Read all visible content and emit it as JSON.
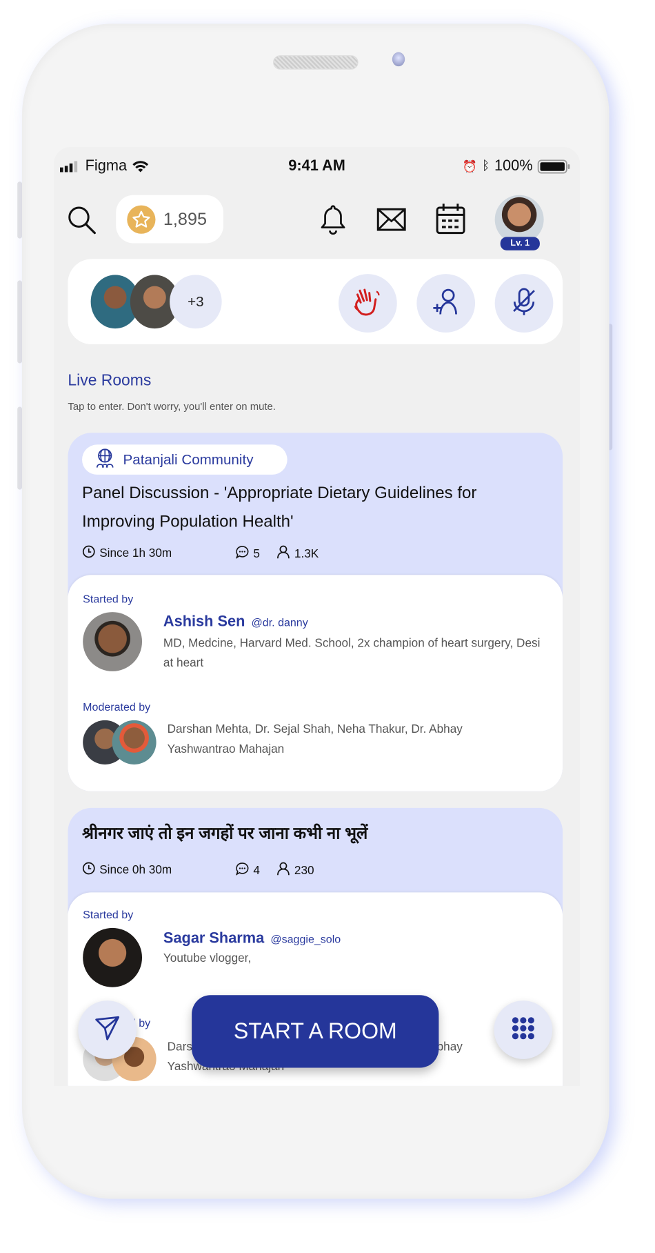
{
  "status_bar": {
    "carrier": "Figma",
    "time": "9:41 AM",
    "battery": "100%"
  },
  "header": {
    "coins": "1,895",
    "level_badge": "Lv. 1",
    "icons": [
      "search-icon",
      "star-coin-icon",
      "bell-icon",
      "mail-icon",
      "calendar-icon"
    ]
  },
  "active_bar": {
    "more_count": "+3",
    "actions": [
      "wave-hand-icon",
      "add-user-icon",
      "mic-off-icon"
    ]
  },
  "live_rooms": {
    "title": "Live Rooms",
    "subtitle": "Tap to enter. Don't worry, you'll enter on mute."
  },
  "rooms": [
    {
      "community": "Patanjali Community",
      "title": "Panel Discussion - 'Appropriate Dietary Guidelines for Improving Population Health'",
      "since": "Since 1h 30m",
      "comments": "5",
      "listeners": "1.3K",
      "started_by_label": "Started by",
      "host_name": "Ashish Sen",
      "host_handle": "@dr. danny",
      "host_bio": "MD, Medcine, Harvard Med. School, 2x champion of heart surgery, Desi at heart",
      "moderated_by_label": "Moderated by",
      "moderators": "Darshan Mehta, Dr. Sejal Shah, Neha Thakur, Dr. Abhay Yashwantrao Mahajan"
    },
    {
      "title": "श्रीनगर जाएं तो इन जगहों पर जाना कभी ना भूलें",
      "since": "Since 0h 30m",
      "comments": "4",
      "listeners": "230",
      "started_by_label": "Started by",
      "host_name": "Sagar Sharma",
      "host_handle": "@saggie_solo",
      "host_bio": "Youtube vlogger,",
      "moderated_by_label": "Moderated by",
      "moderators": "Darshan Mehta, Dr. Sejal Shah, Neha Thakur, Dr. Abhay Yashwantrao Mahajan"
    }
  ],
  "bottom": {
    "start_room": "START A ROOM"
  },
  "colors": {
    "primary": "#25369a",
    "room_bg": "#dbe0fc",
    "coin": "#e8b45a",
    "wave": "#d21f1f"
  }
}
